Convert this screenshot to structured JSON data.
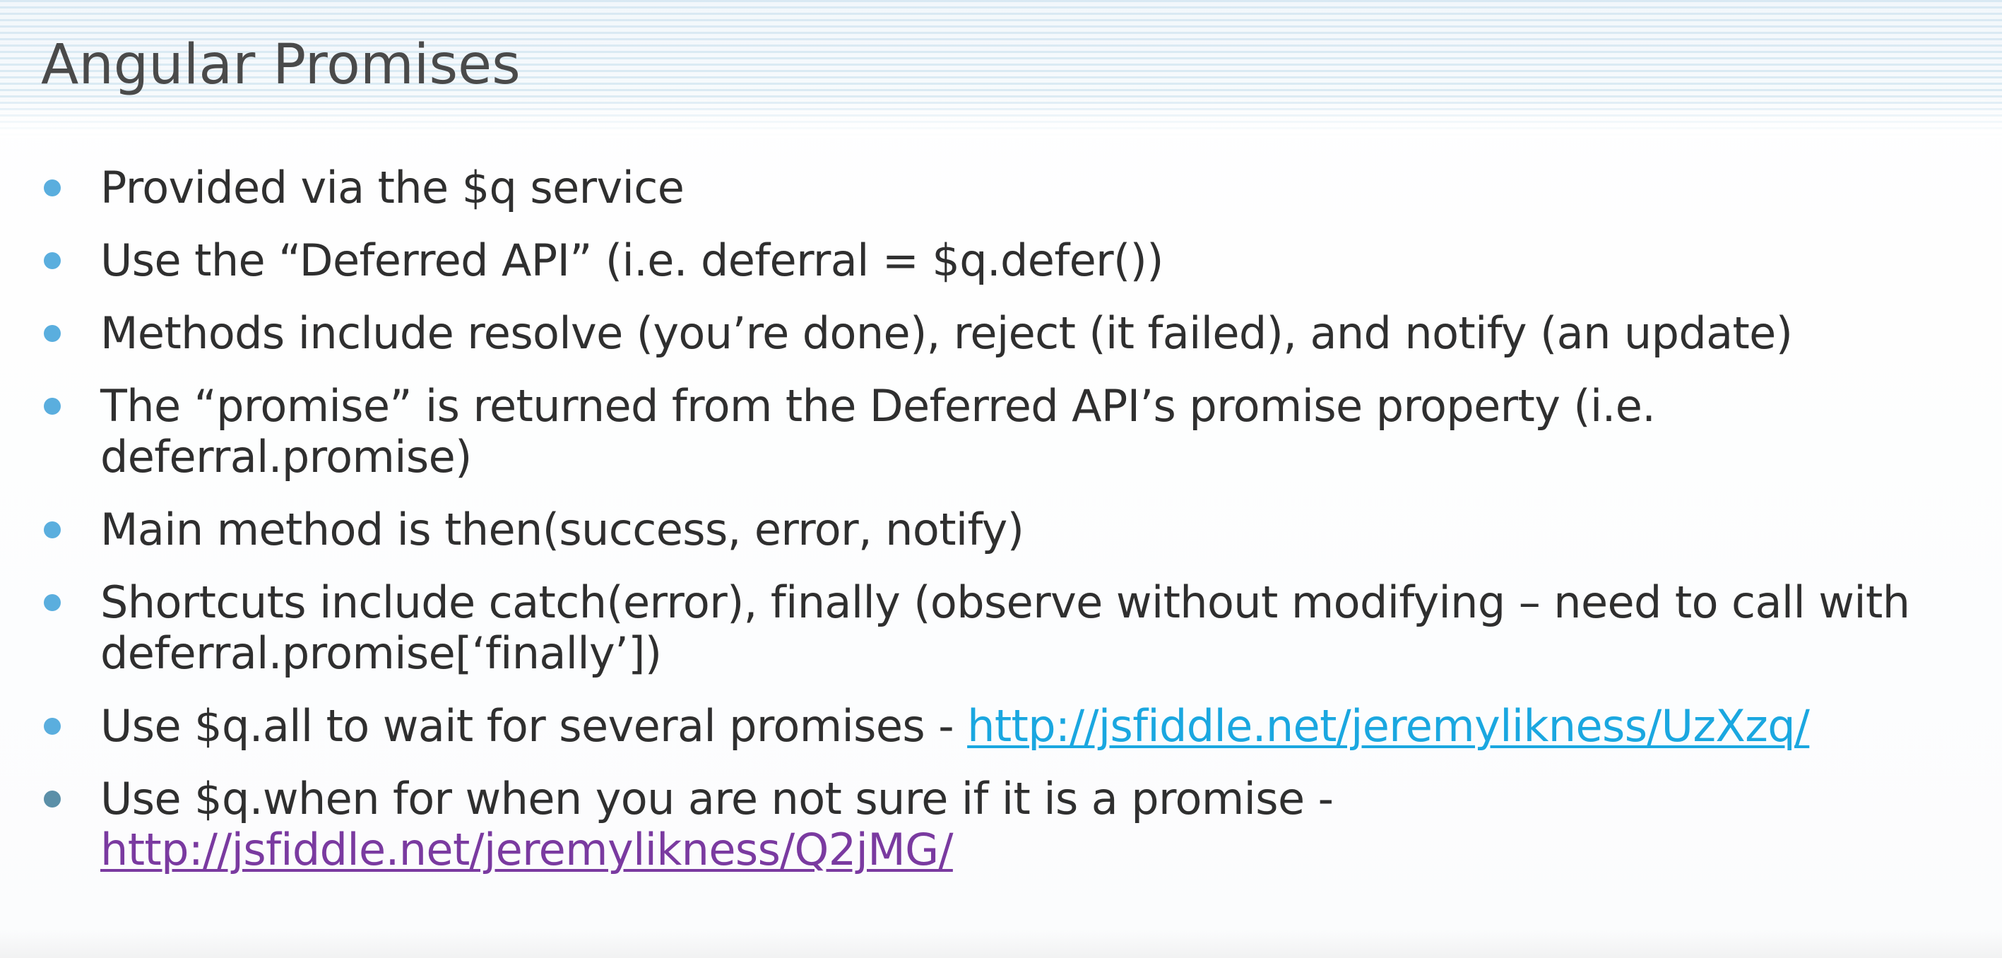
{
  "slide": {
    "title": "Angular Promises",
    "bullets": [
      {
        "text": "Provided via the $q service"
      },
      {
        "text": "Use the “Deferred API” (i.e. deferral = $q.defer())"
      },
      {
        "text": "Methods include resolve (you’re done), reject (it failed), and notify (an update)"
      },
      {
        "text": "The “promise” is returned from the Deferred API’s promise property (i.e. deferral.promise)"
      },
      {
        "text": "Main method is then(success, error, notify)"
      },
      {
        "text": "Shortcuts include catch(error), finally (observe without modifying – need to call with deferral.promise[‘finally’])"
      },
      {
        "text": "Use $q.all to wait for several promises - ",
        "link": "http://jsfiddle.net/jeremylikness/UzXzq/"
      },
      {
        "text": "Use $q.when for when you are not sure if it is a promise - ",
        "link": "http://jsfiddle.net/jeremylikness/Q2jMG/"
      }
    ]
  },
  "colors": {
    "bullet": "#5aaede",
    "title_text": "#4a4a4a",
    "body_text": "#2f2f2f",
    "link_unvisited": "#1aa7e0",
    "link_visited": "#7a3aa0"
  }
}
